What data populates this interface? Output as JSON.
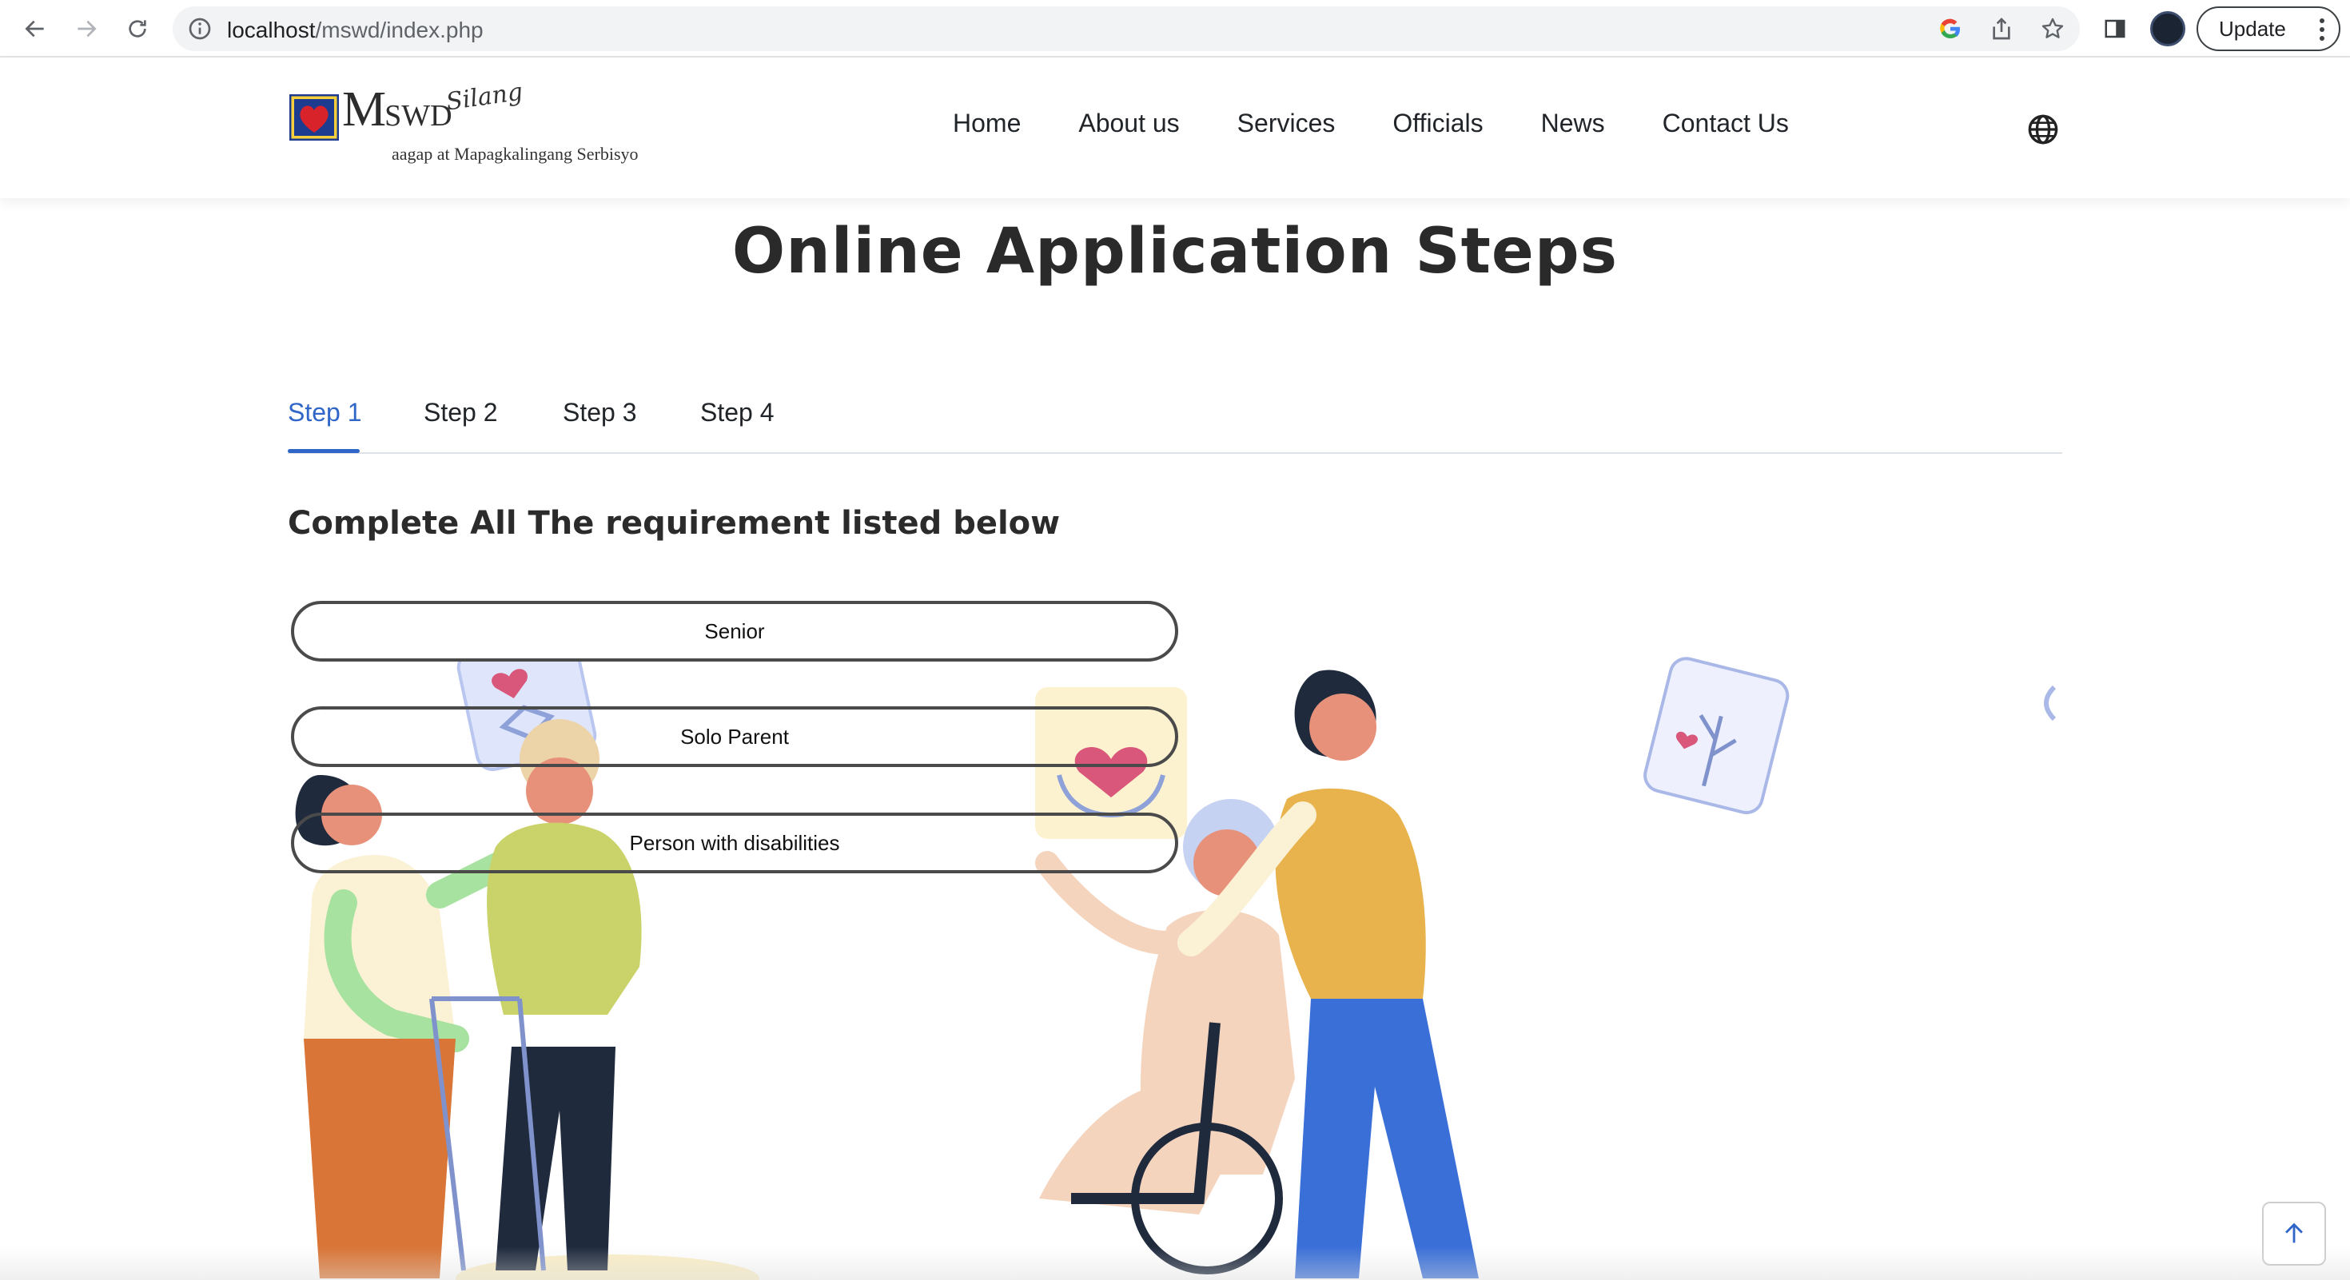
{
  "browser": {
    "url_host": "localhost",
    "url_path": "/mswd/index.php",
    "update_label": "Update"
  },
  "site": {
    "logo": {
      "brand_big": "M",
      "brand_small": "SWD",
      "script": "Silang",
      "tagline": "aagap at Mapagkalingang Serbisyo"
    },
    "nav": [
      "Home",
      "About us",
      "Services",
      "Officials",
      "News",
      "Contact Us"
    ]
  },
  "page": {
    "title": "Online Application Steps",
    "tabs": [
      "Step 1",
      "Step 2",
      "Step 3",
      "Step 4"
    ],
    "active_tab": "Step 1",
    "heading": "Complete All The requirement listed below",
    "requirements": [
      "Senior",
      "Solo Parent",
      "Person with disabilities"
    ]
  },
  "colors": {
    "accent": "#2f66c8",
    "text": "#212529"
  }
}
